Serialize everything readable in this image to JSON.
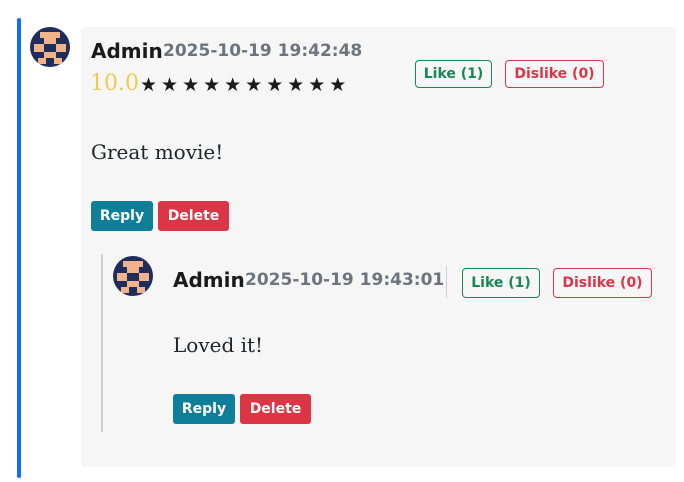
{
  "comment": {
    "author": "Admin",
    "timestamp": "2025-10-19 19:42:48",
    "rating": "10.0",
    "stars": "★★★★★★★★★★",
    "body": "Great movie!",
    "like_label": "Like (1)",
    "dislike_label": "Dislike (0)",
    "reply_label": "Reply",
    "delete_label": "Delete"
  },
  "reply": {
    "author": "Admin",
    "timestamp": "2025-10-19 19:43:01",
    "body": "Loved it!",
    "like_label": "Like (1)",
    "dislike_label": "Dislike (0)",
    "reply_label": "Reply",
    "delete_label": "Delete"
  },
  "colors": {
    "thread_accent": "#0d6efd",
    "like": "#198754",
    "dislike": "#dc3545",
    "reply_button": "#0f7f99",
    "rating": "#f2c94c"
  },
  "icons": {
    "avatar": "identicon-avatar-icon"
  }
}
